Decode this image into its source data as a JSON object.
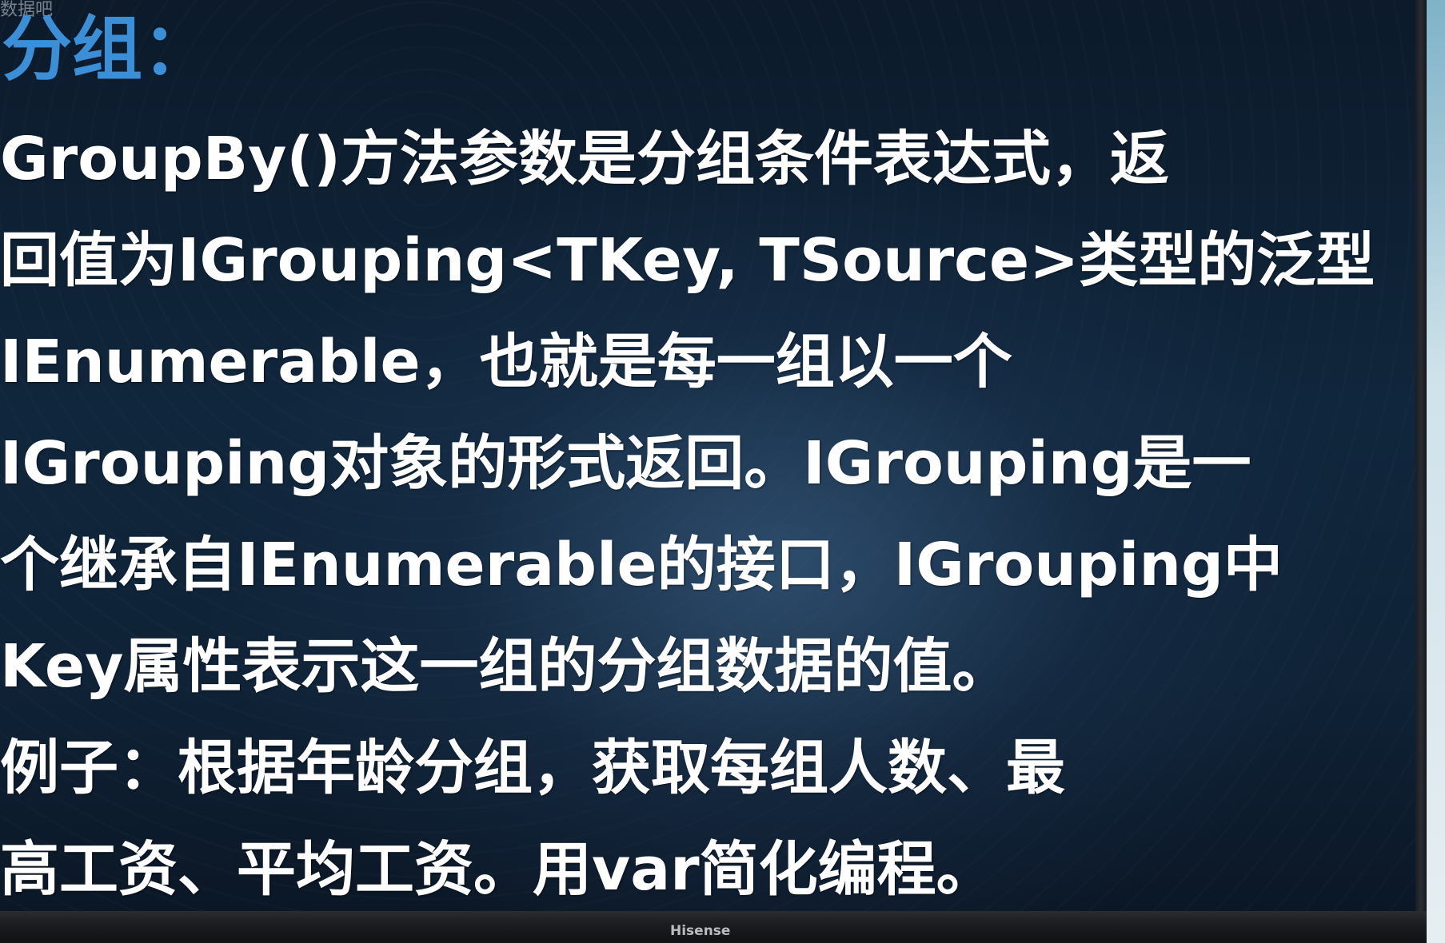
{
  "watermark": "数据吧",
  "slide": {
    "title": "分组：",
    "lines": [
      "GroupBy()方法参数是分组条件表达式，返",
      "回值为IGrouping<TKey, TSource>类型的泛型",
      "IEnumerable，也就是每一组以一个",
      "IGrouping对象的形式返回。IGrouping是一",
      "个继承自IEnumerable的接口，IGrouping中",
      "Key属性表示这一组的分组数据的值。",
      "例子：根据年龄分组，获取每组人数、最",
      "高工资、平均工资。用var简化编程。"
    ]
  },
  "monitor": {
    "brand": "Hisense"
  },
  "colors": {
    "title": "#3b8fd6",
    "body_text": "#ffffff",
    "background": "#10263c"
  }
}
